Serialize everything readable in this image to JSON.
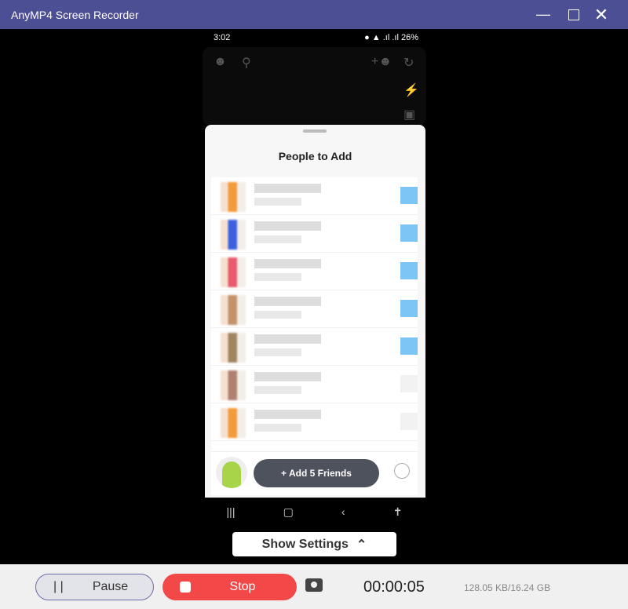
{
  "window": {
    "title": "AnyMP4 Screen Recorder"
  },
  "phone": {
    "status": {
      "time": "3:02",
      "battery": "26%"
    },
    "sheet_title": "People to Add",
    "add_button": "+ Add 5 Friends",
    "friends": [
      {
        "color": "#f39a3a",
        "selected": true
      },
      {
        "color": "#3c5fe0",
        "selected": true
      },
      {
        "color": "#e85a6c",
        "selected": true
      },
      {
        "color": "#c4926a",
        "selected": true
      },
      {
        "color": "#a08660",
        "selected": true
      },
      {
        "color": "#b08070",
        "selected": false
      },
      {
        "color": "#f39a3a",
        "selected": false
      }
    ]
  },
  "settings": {
    "label": "Show Settings"
  },
  "controls": {
    "pause": "Pause",
    "stop": "Stop",
    "elapsed": "00:00:05",
    "size": "128.05 KB/16.24 GB"
  },
  "colors": {
    "titlebar": "#4d4f94",
    "stop": "#f24848"
  }
}
